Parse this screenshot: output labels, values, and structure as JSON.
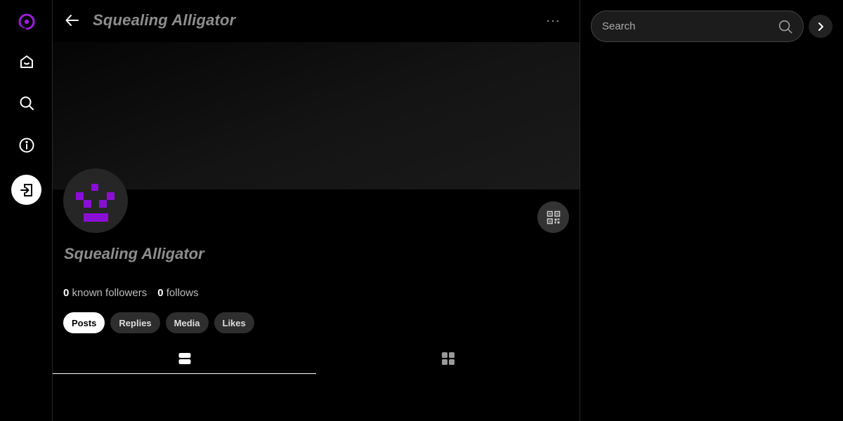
{
  "nav": {
    "icons": [
      "logo-icon",
      "home-icon",
      "search-icon",
      "info-icon",
      "login-icon"
    ],
    "accent_color": "#9b1fd6"
  },
  "header": {
    "title": "Squealing Alligator",
    "more_icon": "more-horizontal-icon"
  },
  "profile": {
    "name": "Squealing Alligator",
    "followers_count": "0",
    "followers_label": " known followers",
    "follows_count": "0",
    "follows_label": " follows",
    "avatar_color": "#8a0fd6"
  },
  "filters": {
    "posts": "Posts",
    "replies": "Replies",
    "media": "Media",
    "likes": "Likes",
    "active": "Posts"
  },
  "view_tabs": {
    "list_icon": "list-view-icon",
    "grid_icon": "grid-view-icon",
    "active": "list"
  },
  "search": {
    "placeholder": "Search"
  }
}
